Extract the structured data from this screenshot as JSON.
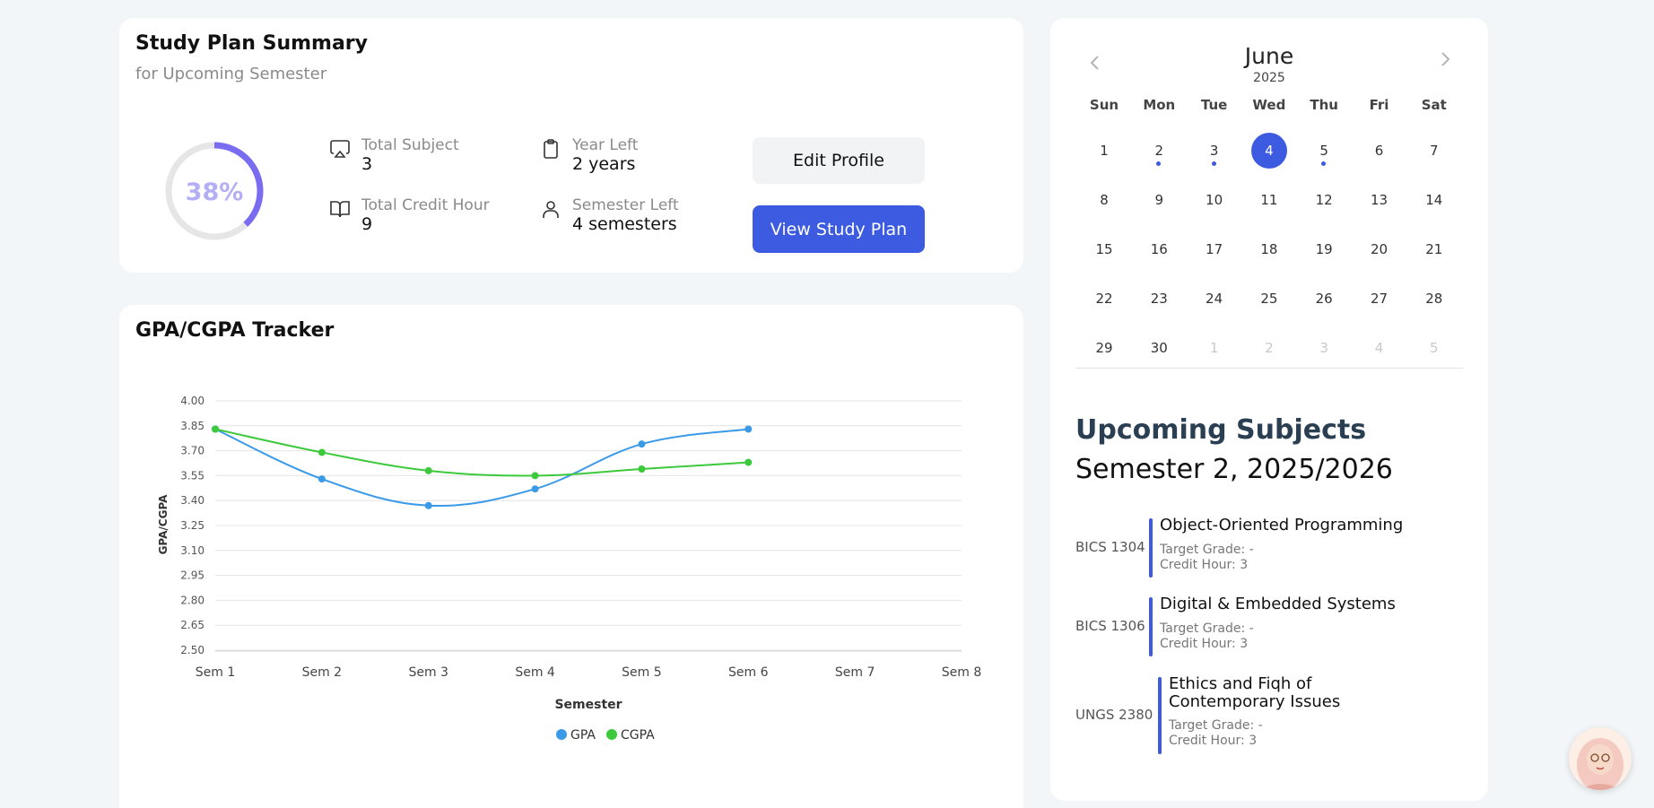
{
  "summary": {
    "title": "Study Plan Summary",
    "subtitle": "for Upcoming Semester",
    "progress_percent": 38,
    "progress_label": "38%",
    "stats": [
      {
        "icon": "airplay-icon",
        "label": "Total Subject",
        "value": "3"
      },
      {
        "icon": "book-open-icon",
        "label": "Total Credit Hour",
        "value": "9"
      },
      {
        "icon": "clipboard-icon",
        "label": "Year Left",
        "value": "2 years"
      },
      {
        "icon": "user-icon",
        "label": "Semester Left",
        "value": "4 semesters"
      }
    ],
    "edit_label": "Edit Profile",
    "view_label": "View Study Plan"
  },
  "tracker": {
    "title": "GPA/CGPA Tracker"
  },
  "chart_data": {
    "type": "line",
    "title": "",
    "xlabel": "Semester",
    "ylabel": "GPA/CGPA",
    "categories": [
      "Sem 1",
      "Sem 2",
      "Sem 3",
      "Sem 4",
      "Sem 5",
      "Sem 6",
      "Sem 7",
      "Sem 8"
    ],
    "yticks": [
      "4.00",
      "3.85",
      "3.70",
      "3.55",
      "3.40",
      "3.25",
      "3.10",
      "2.95",
      "2.80",
      "2.65",
      "2.50"
    ],
    "ylim": [
      2.5,
      4.0
    ],
    "grid": true,
    "legend": "bottom",
    "series": [
      {
        "name": "GPA",
        "color": "#3b9ae8",
        "values": [
          3.83,
          3.53,
          3.37,
          3.47,
          3.74,
          3.83
        ]
      },
      {
        "name": "CGPA",
        "color": "#3cc93c",
        "values": [
          3.83,
          3.69,
          3.58,
          3.55,
          3.59,
          3.63
        ]
      }
    ]
  },
  "calendar": {
    "month": "June",
    "year": "2025",
    "weekdays": [
      "Sun",
      "Mon",
      "Tue",
      "Wed",
      "Thu",
      "Fri",
      "Sat"
    ],
    "weeks": [
      [
        {
          "d": "1"
        },
        {
          "d": "2",
          "dot": true
        },
        {
          "d": "3",
          "dot": true
        },
        {
          "d": "4",
          "today": true
        },
        {
          "d": "5",
          "dot": true
        },
        {
          "d": "6"
        },
        {
          "d": "7"
        }
      ],
      [
        {
          "d": "8"
        },
        {
          "d": "9"
        },
        {
          "d": "10"
        },
        {
          "d": "11"
        },
        {
          "d": "12"
        },
        {
          "d": "13"
        },
        {
          "d": "14"
        }
      ],
      [
        {
          "d": "15"
        },
        {
          "d": "16"
        },
        {
          "d": "17"
        },
        {
          "d": "18"
        },
        {
          "d": "19"
        },
        {
          "d": "20"
        },
        {
          "d": "21"
        }
      ],
      [
        {
          "d": "22"
        },
        {
          "d": "23"
        },
        {
          "d": "24"
        },
        {
          "d": "25"
        },
        {
          "d": "26"
        },
        {
          "d": "27"
        },
        {
          "d": "28"
        }
      ],
      [
        {
          "d": "29"
        },
        {
          "d": "30"
        },
        {
          "d": "1",
          "muted": true
        },
        {
          "d": "2",
          "muted": true
        },
        {
          "d": "3",
          "muted": true
        },
        {
          "d": "4",
          "muted": true
        },
        {
          "d": "5",
          "muted": true
        }
      ]
    ]
  },
  "upcoming": {
    "title": "Upcoming Subjects",
    "semester": "Semester 2, 2025/2026",
    "subjects": [
      {
        "code": "BICS 1304",
        "name": "Object-Oriented Programming",
        "grade": "Target Grade: -",
        "credit": "Credit Hour: 3"
      },
      {
        "code": "BICS 1306",
        "name": "Digital & Embedded Systems",
        "grade": "Target Grade: -",
        "credit": "Credit Hour: 3"
      },
      {
        "code": "UNGS 2380",
        "name": "Ethics and Fiqh of Contemporary Issues",
        "grade": "Target Grade: -",
        "credit": "Credit Hour: 3"
      }
    ]
  },
  "colors": {
    "accent": "#3d5be0",
    "gpa": "#3b9ae8",
    "cgpa": "#3cc93c",
    "progress": "#7a6cf0"
  }
}
